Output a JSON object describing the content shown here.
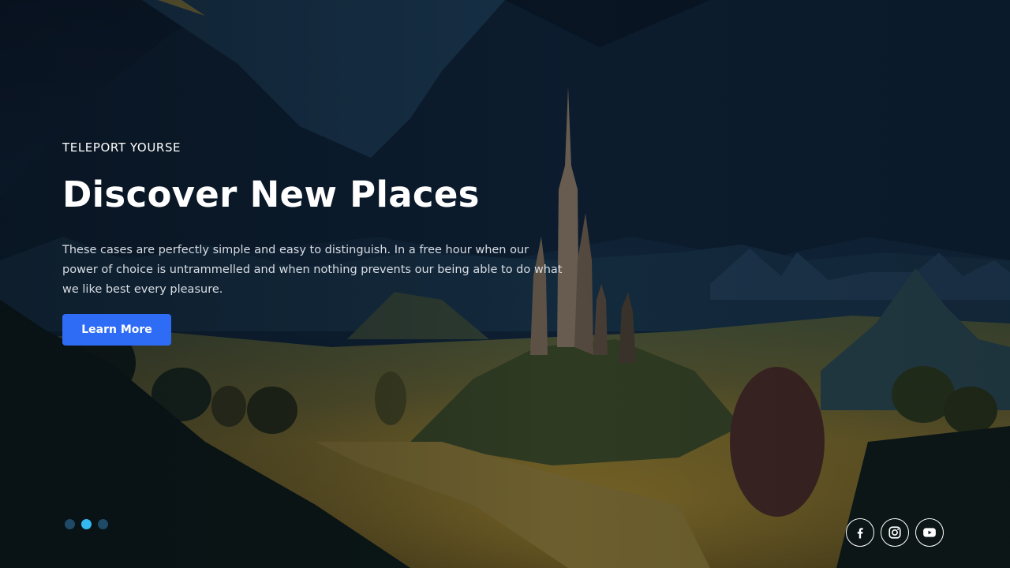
{
  "hero": {
    "kicker": "TELEPORT YOURSE",
    "title": "Discover New Places",
    "description": "These cases are perfectly simple and easy to distinguish. In a free hour when our power of choice is untrammelled and when nothing prevents our being able to do what we like best every pleasure.",
    "cta_label": "Learn More"
  },
  "slider": {
    "dot_count": 3,
    "active_index": 1
  },
  "socials": [
    {
      "name": "facebook",
      "icon": "facebook-icon"
    },
    {
      "name": "instagram",
      "icon": "instagram-icon"
    },
    {
      "name": "youtube",
      "icon": "youtube-icon"
    }
  ],
  "colors": {
    "accent": "#2e6cf6",
    "dot_active": "#34b8f2",
    "dot_inactive": "#1e4a68",
    "text": "#ffffff"
  }
}
